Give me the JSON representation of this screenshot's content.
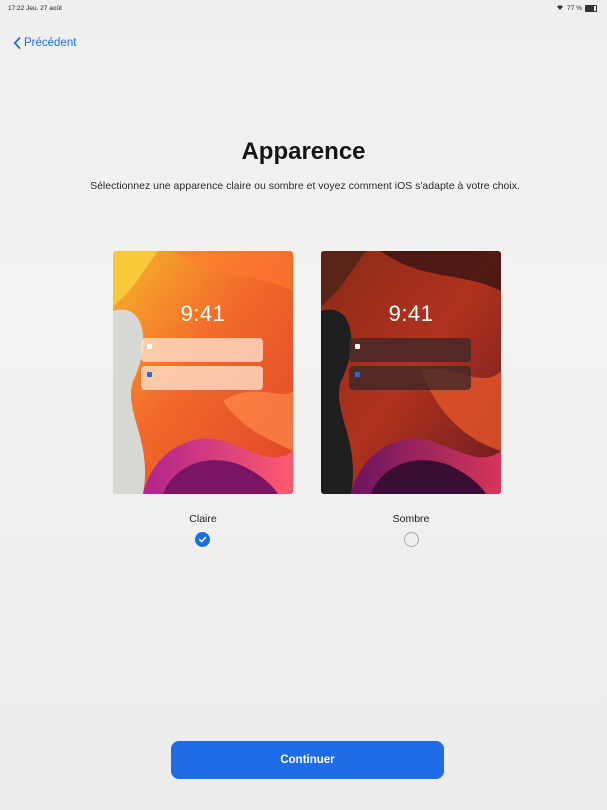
{
  "status_bar": {
    "time": "17:22",
    "date": "Jeu. 27 août",
    "battery": "77 %",
    "battery_level": 0.77,
    "wifi_icon": "wifi-icon",
    "battery_icon": "battery-icon"
  },
  "nav": {
    "back_label": "Précédent",
    "back_icon": "chevron-left-icon"
  },
  "page": {
    "title": "Apparence",
    "subtitle": "Sélectionnez une apparence claire ou sombre et voyez comment iOS s'adapte à votre choix."
  },
  "options": [
    {
      "id": "light",
      "label": "Claire",
      "preview_time": "9:41",
      "selected": true,
      "notification_dot_colors": [
        "#ffffff",
        "#1a6fe5"
      ]
    },
    {
      "id": "dark",
      "label": "Sombre",
      "preview_time": "9:41",
      "selected": false,
      "notification_dot_colors": [
        "#ffffff",
        "#1a6fe5"
      ]
    }
  ],
  "footer": {
    "continue_label": "Continuer"
  },
  "colors": {
    "accent": "#1a6fe5",
    "button": "#1f6ce8",
    "background": "#efefed"
  }
}
